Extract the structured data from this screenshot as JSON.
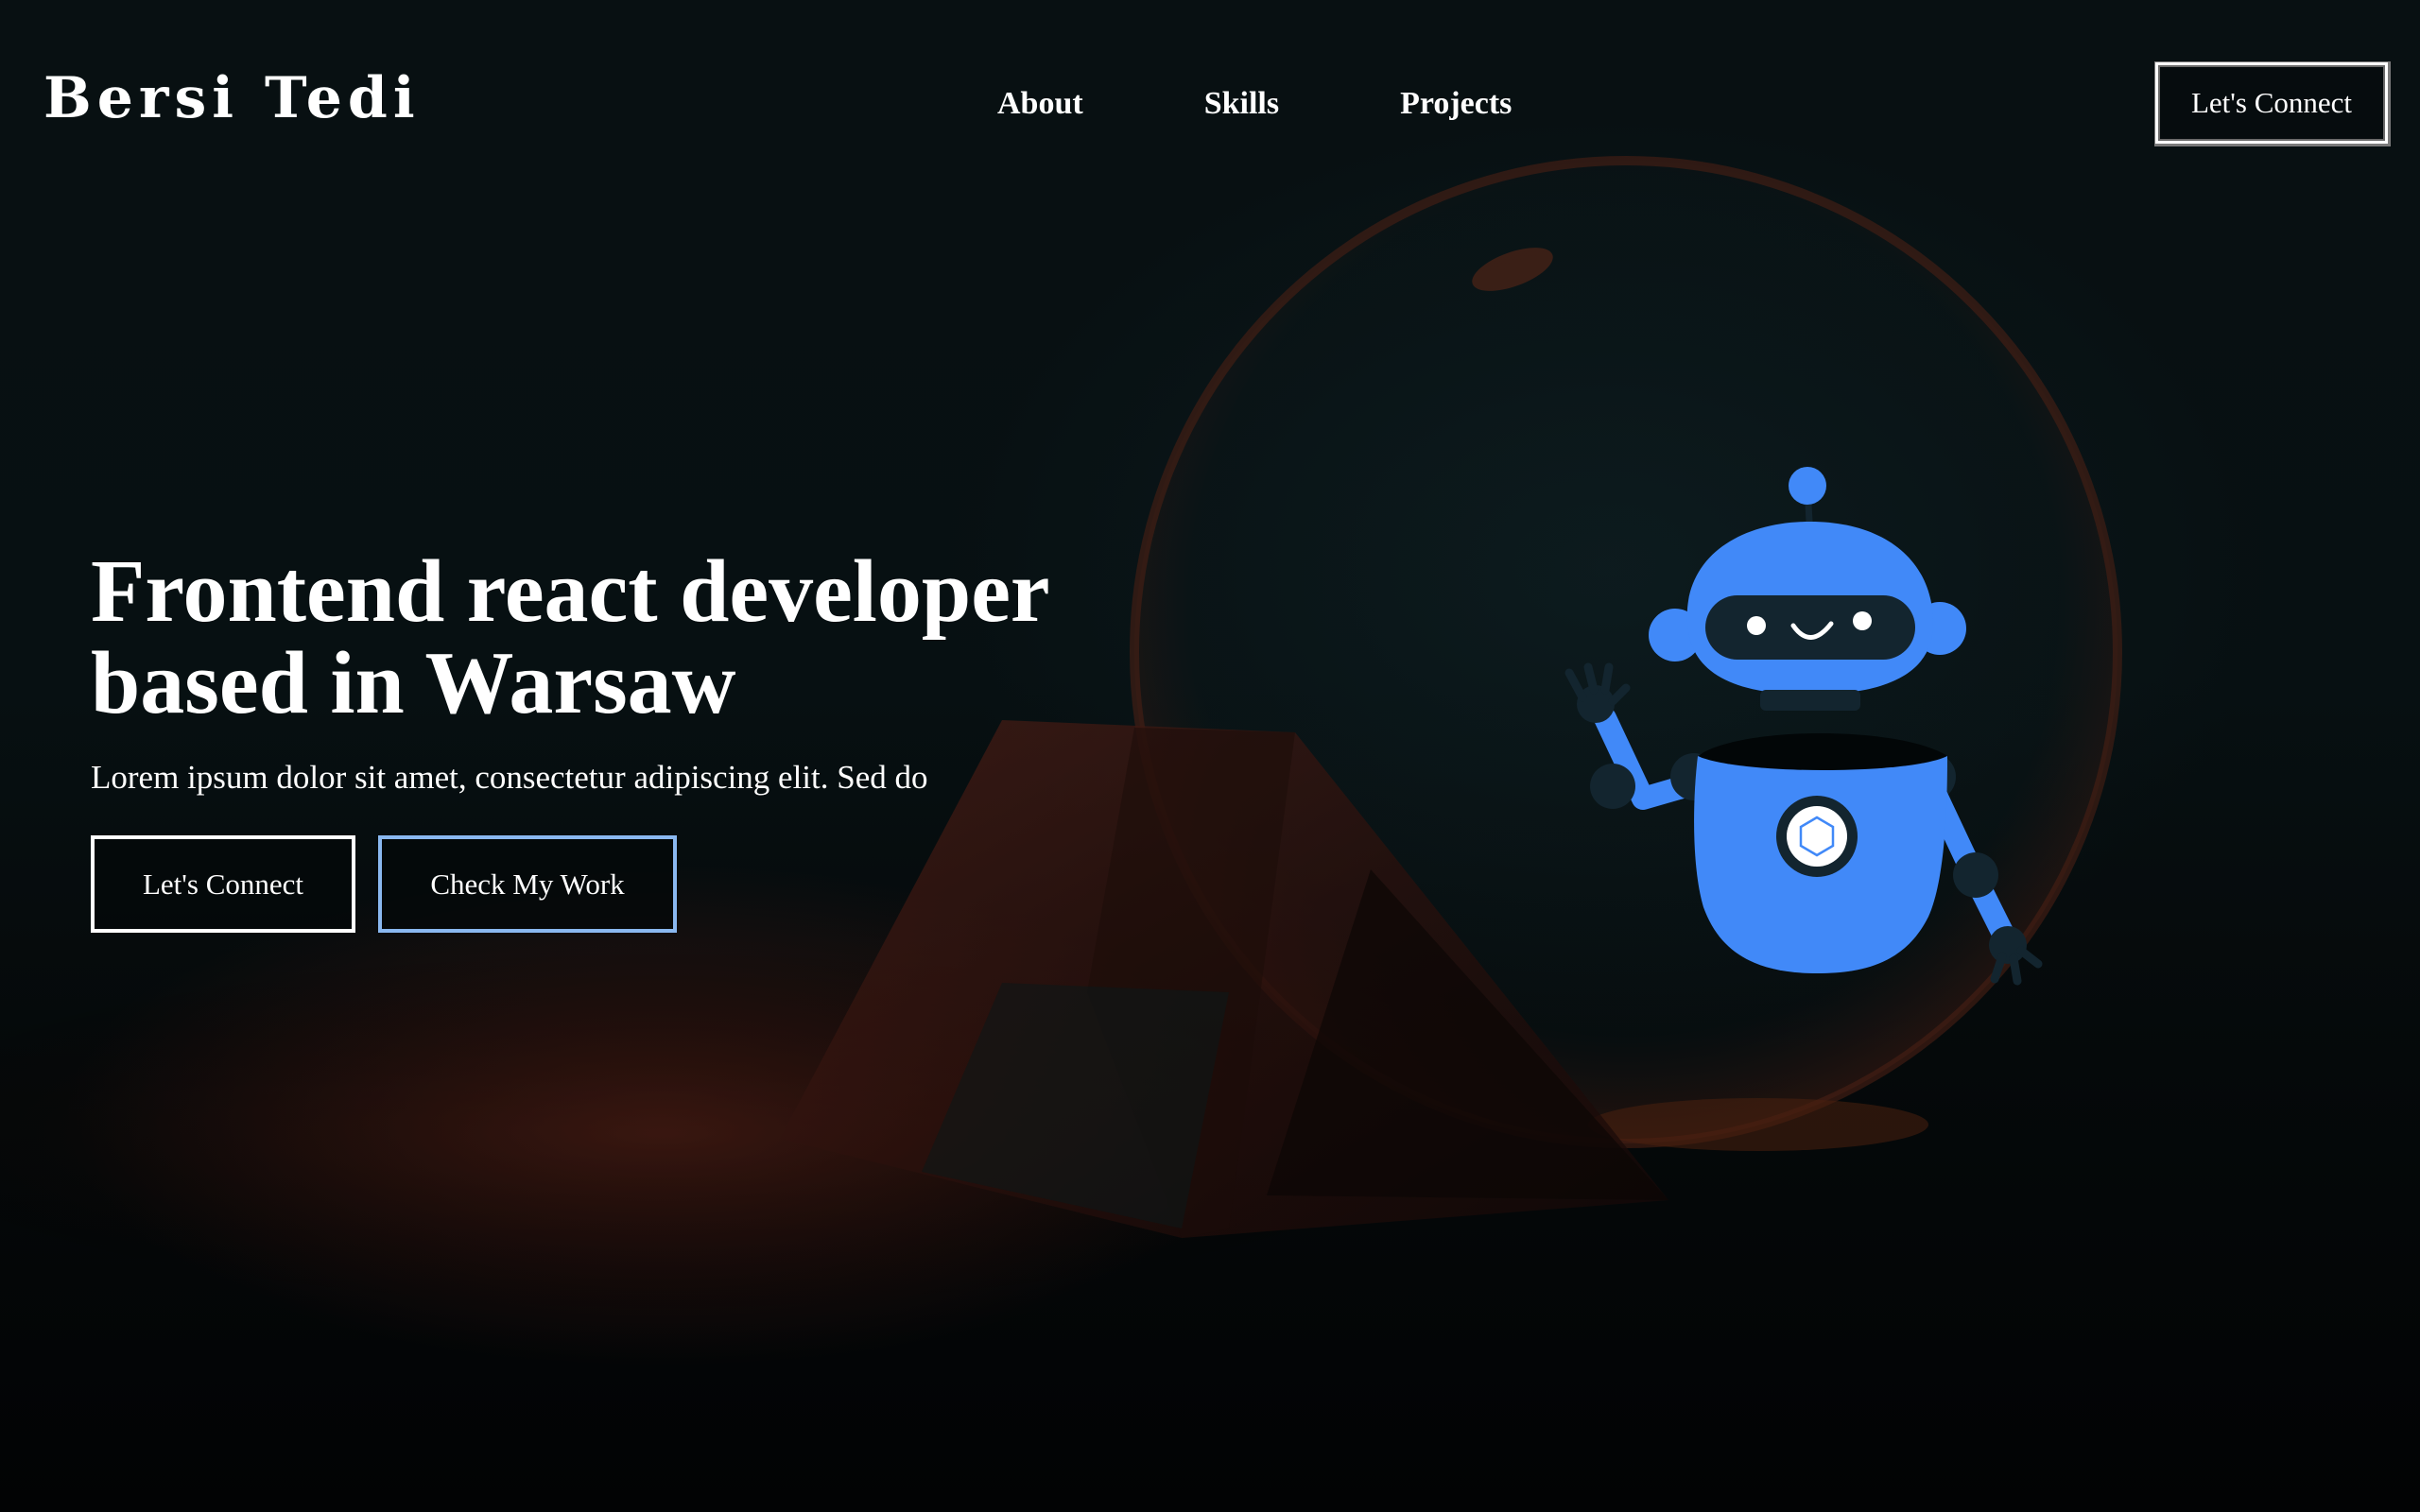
{
  "header": {
    "logo": "Bersi Tedi",
    "nav": [
      {
        "label": "About"
      },
      {
        "label": "Skills"
      },
      {
        "label": "Projects"
      }
    ],
    "cta_label": "Let's Connect"
  },
  "hero": {
    "title_line1": "Frontend react developer",
    "title_line2": "based in Warsaw",
    "subtitle": "Lorem ipsum dolor sit amet, consectetur adipiscing elit. Sed do",
    "primary_button": "Let's Connect",
    "secondary_button": "Check My Work"
  },
  "colors": {
    "background": "#05090a",
    "robot_blue": "#4189f8",
    "robot_dark": "#13252f",
    "secondary_button_border": "#8ab8f0"
  },
  "icons": {
    "robot": "robot-illustration",
    "background": "glass-sphere-and-prism-photo"
  }
}
